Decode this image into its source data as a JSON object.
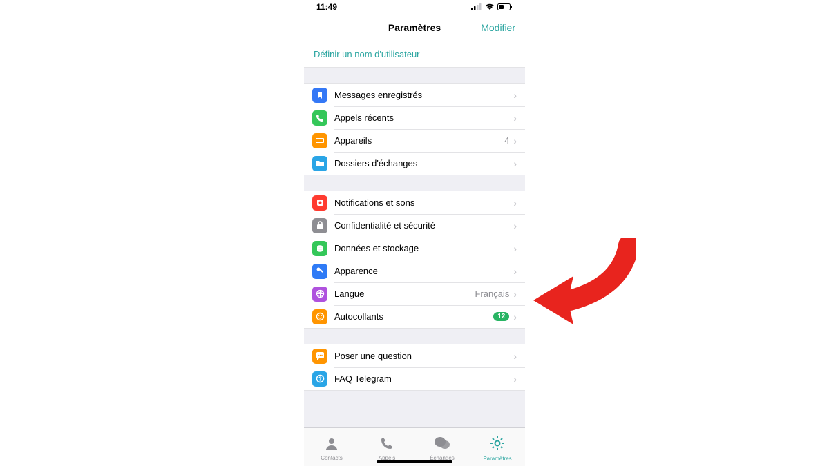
{
  "status": {
    "time": "11:49"
  },
  "nav": {
    "title": "Paramètres",
    "edit": "Modifier"
  },
  "username_link": "Définir un nom d'utilisateur",
  "group1": [
    {
      "icon": "bookmark",
      "color": "#3478f6",
      "label": "Messages enregistrés",
      "value": "",
      "badge": ""
    },
    {
      "icon": "phone",
      "color": "#34c759",
      "label": "Appels récents",
      "value": "",
      "badge": ""
    },
    {
      "icon": "devices",
      "color": "#ff9500",
      "label": "Appareils",
      "value": "4",
      "badge": ""
    },
    {
      "icon": "folder",
      "color": "#2aa5e6",
      "label": "Dossiers d'échanges",
      "value": "",
      "badge": ""
    }
  ],
  "group2": [
    {
      "icon": "bell",
      "color": "#ff3b30",
      "label": "Notifications et sons",
      "value": "",
      "badge": ""
    },
    {
      "icon": "lock",
      "color": "#8e8e93",
      "label": "Confidentialité et sécurité",
      "value": "",
      "badge": ""
    },
    {
      "icon": "data",
      "color": "#34c759",
      "label": "Données et stockage",
      "value": "",
      "badge": ""
    },
    {
      "icon": "appearance",
      "color": "#2f7bf6",
      "label": "Apparence",
      "value": "",
      "badge": ""
    },
    {
      "icon": "globe",
      "color": "#af52de",
      "label": "Langue",
      "value": "Français",
      "badge": ""
    },
    {
      "icon": "sticker",
      "color": "#ff9500",
      "label": "Autocollants",
      "value": "",
      "badge": "12"
    }
  ],
  "group3": [
    {
      "icon": "chat",
      "color": "#ff9500",
      "label": "Poser une question",
      "value": "",
      "badge": ""
    },
    {
      "icon": "faq",
      "color": "#2aa5e6",
      "label": "FAQ Telegram",
      "value": "",
      "badge": ""
    }
  ],
  "tabs": [
    {
      "name": "contacts",
      "label": "Contacts"
    },
    {
      "name": "calls",
      "label": "Appels"
    },
    {
      "name": "chats",
      "label": "Échanges"
    },
    {
      "name": "settings",
      "label": "Paramètres"
    }
  ],
  "active_tab": 3
}
